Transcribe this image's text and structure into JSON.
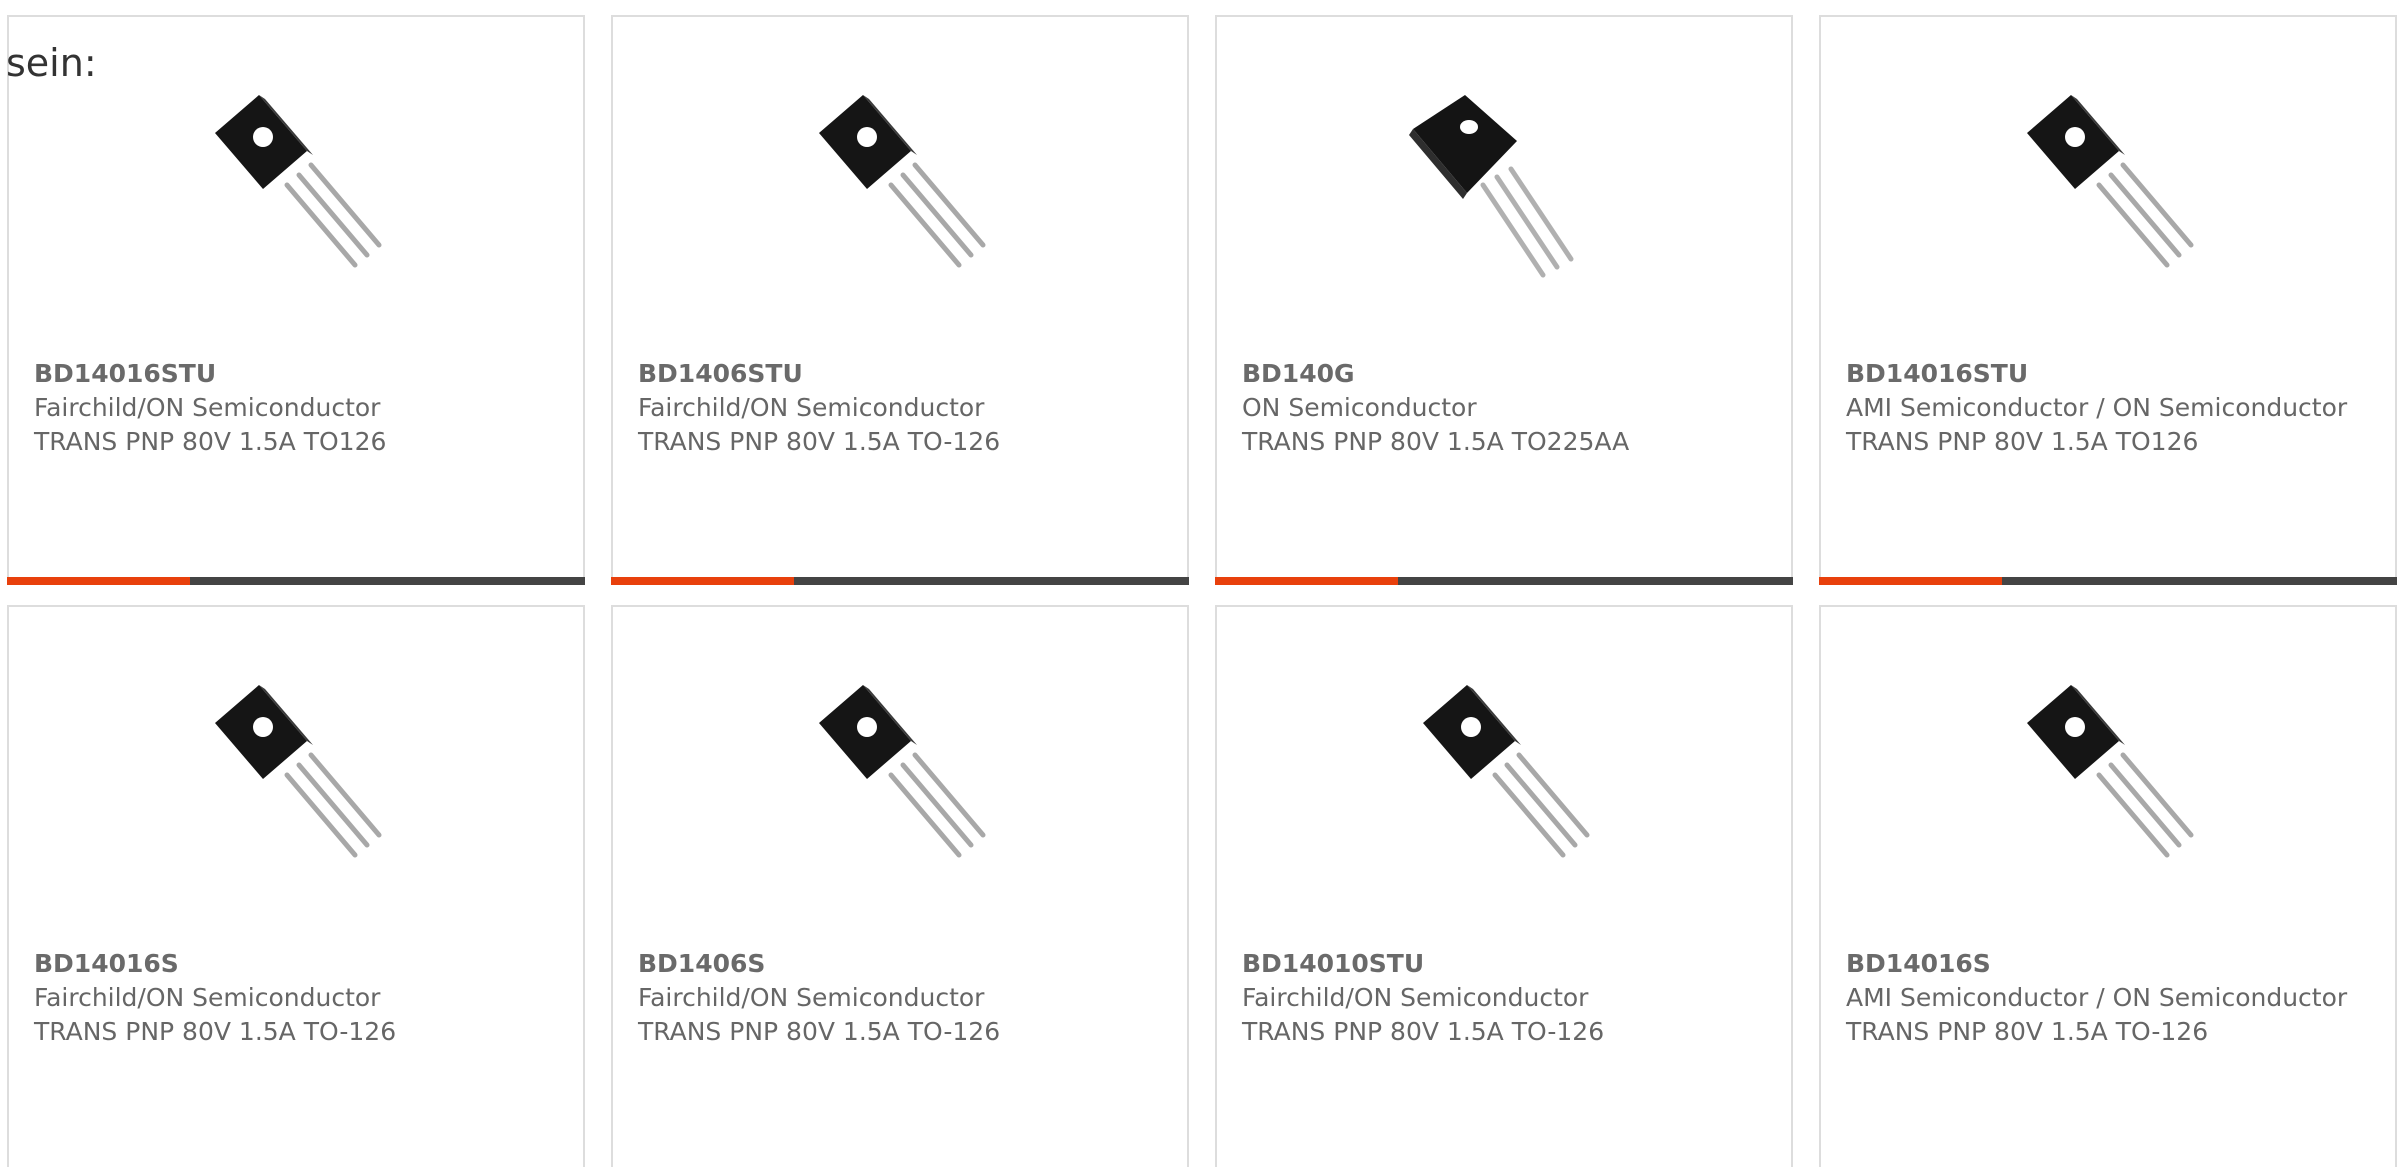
{
  "intro": {
    "text": "sein:"
  },
  "colors": {
    "accent": "#e8400c",
    "bar": "#444444",
    "border": "#dddddd",
    "text": "#666666"
  },
  "products": [
    {
      "part": "BD14016STU",
      "manufacturer": "Fairchild/ON Semiconductor",
      "description": "TRANS PNP 80V 1.5A TO126",
      "image": "to126-transistor-icon"
    },
    {
      "part": "BD1406STU",
      "manufacturer": "Fairchild/ON Semiconductor",
      "description": "TRANS PNP 80V 1.5A TO-126",
      "image": "to126-transistor-icon"
    },
    {
      "part": "BD140G",
      "manufacturer": "ON Semiconductor",
      "description": "TRANS PNP 80V 1.5A TO225AA",
      "image": "to225-transistor-icon"
    },
    {
      "part": "BD14016STU",
      "manufacturer": "AMI Semiconductor / ON Semiconductor",
      "description": "TRANS PNP 80V 1.5A TO126",
      "image": "to126-transistor-icon"
    },
    {
      "part": "BD14016S",
      "manufacturer": "Fairchild/ON Semiconductor",
      "description": "TRANS PNP 80V 1.5A TO-126",
      "image": "to126-transistor-icon"
    },
    {
      "part": "BD1406S",
      "manufacturer": "Fairchild/ON Semiconductor",
      "description": "TRANS PNP 80V 1.5A TO-126",
      "image": "to126-transistor-icon"
    },
    {
      "part": "BD14010STU",
      "manufacturer": "Fairchild/ON Semiconductor",
      "description": "TRANS PNP 80V 1.5A TO-126",
      "image": "to126-transistor-icon"
    },
    {
      "part": "BD14016S",
      "manufacturer": "AMI Semiconductor / ON Semiconductor",
      "description": "TRANS PNP 80V 1.5A TO-126",
      "image": "to126-transistor-icon"
    }
  ]
}
